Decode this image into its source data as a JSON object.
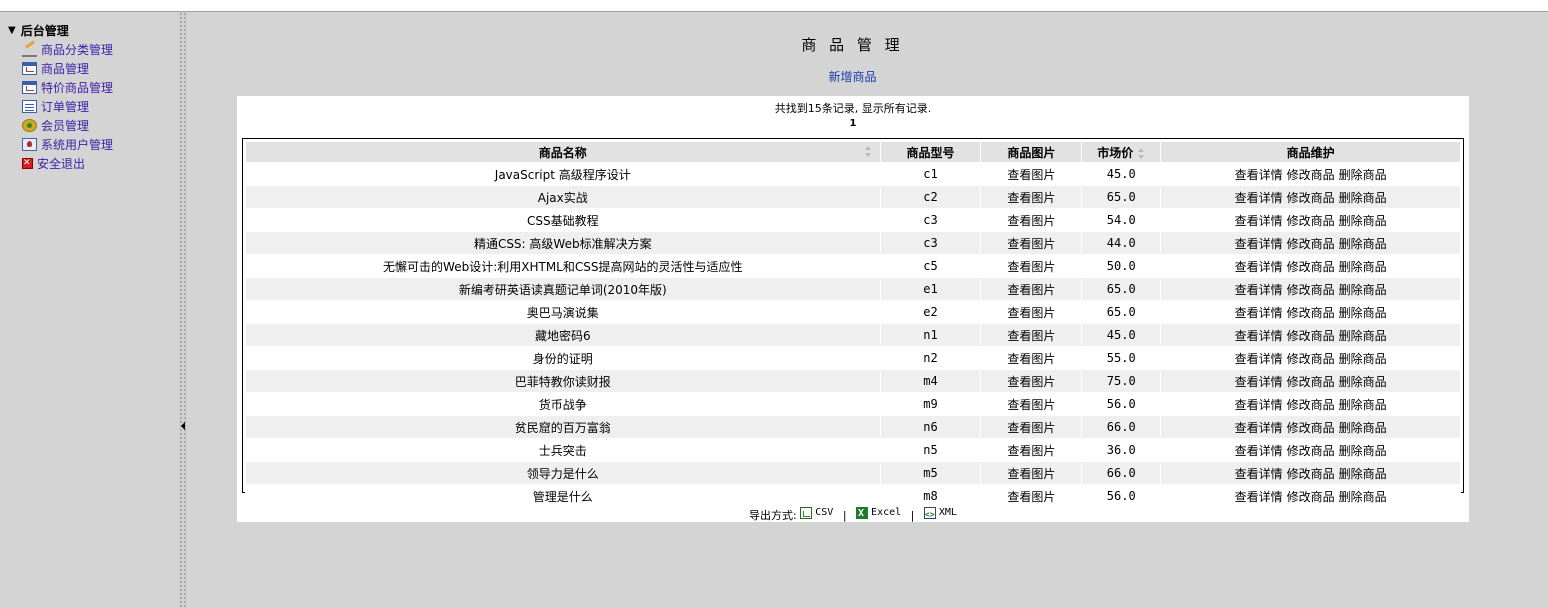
{
  "sidebar": {
    "root_label": "后台管理",
    "items": [
      {
        "label": "商品分类管理",
        "icon": "edit-icon"
      },
      {
        "label": "商品管理",
        "icon": "window-icon"
      },
      {
        "label": "特价商品管理",
        "icon": "window-icon"
      },
      {
        "label": "订单管理",
        "icon": "list-icon"
      },
      {
        "label": "会员管理",
        "icon": "member-icon"
      },
      {
        "label": "系统用户管理",
        "icon": "user-icon"
      },
      {
        "label": "安全退出",
        "icon": "exit-icon"
      }
    ]
  },
  "main": {
    "title": "商 品 管 理",
    "add_link": "新增商品",
    "summary": "共找到15条记录, 显示所有记录.",
    "page": "1",
    "columns": [
      "商品名称",
      "商品型号",
      "商品图片",
      "市场价",
      "商品维护"
    ],
    "actions": {
      "view_image": "查看图片",
      "detail": "查看详情",
      "edit": "修改商品",
      "delete": "删除商品"
    },
    "rows": [
      {
        "name": "JavaScript 高级程序设计",
        "model": "c1",
        "price": "45.0"
      },
      {
        "name": "Ajax实战",
        "model": "c2",
        "price": "65.0"
      },
      {
        "name": "CSS基础教程",
        "model": "c3",
        "price": "54.0"
      },
      {
        "name": "精通CSS: 高级Web标准解决方案",
        "model": "c3",
        "price": "44.0"
      },
      {
        "name": "无懈可击的Web设计:利用XHTML和CSS提高网站的灵活性与适应性",
        "model": "c5",
        "price": "50.0"
      },
      {
        "name": "新编考研英语读真题记单词(2010年版)",
        "model": "e1",
        "price": "65.0"
      },
      {
        "name": "奥巴马演说集",
        "model": "e2",
        "price": "65.0"
      },
      {
        "name": "藏地密码6",
        "model": "n1",
        "price": "45.0"
      },
      {
        "name": "身份的证明",
        "model": "n2",
        "price": "55.0"
      },
      {
        "name": "巴菲特教你读财报",
        "model": "m4",
        "price": "75.0"
      },
      {
        "name": "货币战争",
        "model": "m9",
        "price": "56.0"
      },
      {
        "name": "贫民窟的百万富翁",
        "model": "n6",
        "price": "66.0"
      },
      {
        "name": "士兵突击",
        "model": "n5",
        "price": "36.0"
      },
      {
        "name": "领导力是什么",
        "model": "m5",
        "price": "66.0"
      },
      {
        "name": "管理是什么",
        "model": "m8",
        "price": "56.0"
      }
    ],
    "export": {
      "label": "导出方式:",
      "csv": "CSV",
      "excel": "Excel",
      "xml": "XML",
      "separator": "|"
    }
  }
}
